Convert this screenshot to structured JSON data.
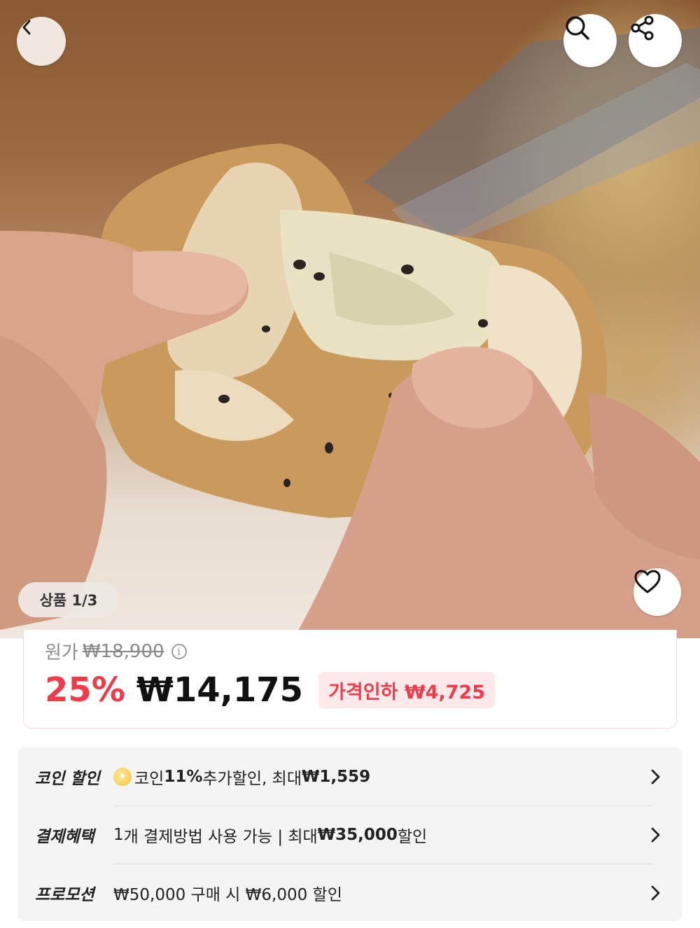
{
  "image_counter": "상품 1/3",
  "price": {
    "original_label": "원가",
    "original_price": "₩18,900",
    "discount_percent": "25%",
    "sale_price": "₩14,175",
    "drop_badge": "가격인하 ₩4,725"
  },
  "benefits": [
    {
      "title": "코인 할인",
      "parts": [
        "코인 ",
        "11%",
        " 추가할인, 최대 ",
        "₩1,559"
      ]
    },
    {
      "title": "결제혜택",
      "parts": [
        "1",
        "개 결제방법 사용 가능 | 최대 ",
        "₩35,000",
        " 할인"
      ]
    },
    {
      "title": "프로모션",
      "parts": [
        "₩50,000 구매 시 ₩6,000 할인"
      ]
    }
  ],
  "icons": {
    "back": "chevron-left-icon",
    "search": "search-icon",
    "share": "share-icon",
    "wishlist": "heart-icon",
    "info": "info-icon",
    "coin": "coin-icon",
    "row_arrow": "chevron-right-icon"
  },
  "colors": {
    "accent": "#ef3b4a",
    "badge_bg": "#fde8ea",
    "panel_bg": "#f4f4f4"
  }
}
